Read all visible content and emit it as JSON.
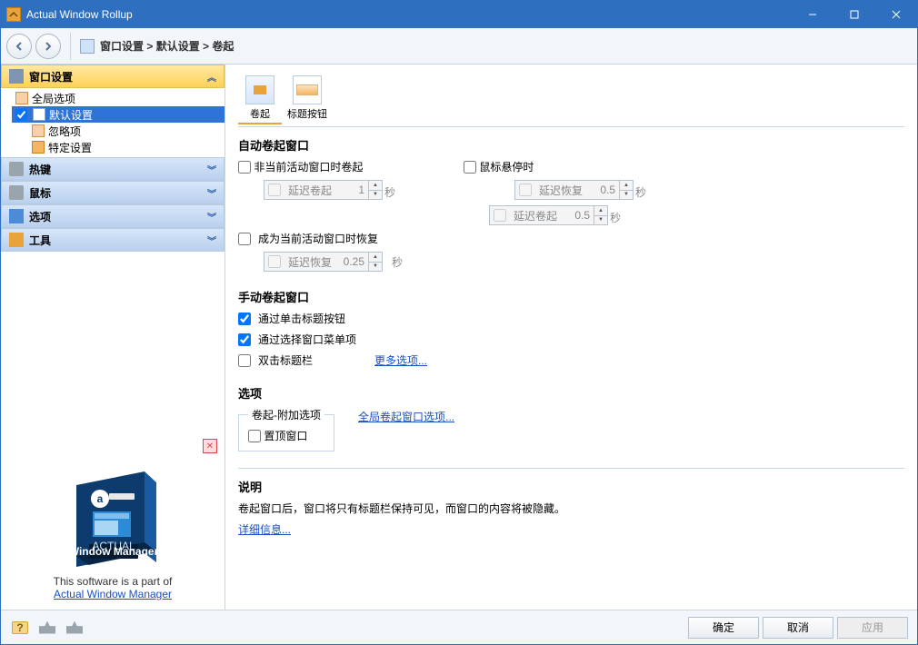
{
  "titlebar": {
    "title": "Actual Window Rollup"
  },
  "breadcrumb": {
    "a": "窗口设置",
    "b": "默认设置",
    "c": "卷起"
  },
  "sidebar": {
    "headers": {
      "window": "窗口设置",
      "hotkey": "热键",
      "mouse": "鼠标",
      "options": "选项",
      "tools": "工具"
    },
    "tree": {
      "global": "全局选项",
      "default": "默认设置",
      "ignore": "忽略项",
      "specific": "特定设置"
    },
    "promo_text": "This software is a part of",
    "promo_link": "Actual Window Manager"
  },
  "tabs": {
    "rollup": "卷起",
    "titlebtn": "标题按钮"
  },
  "auto": {
    "title": "自动卷起窗口",
    "inactive": "非当前活动窗口时卷起",
    "delay_rollup": "延迟卷起",
    "delay_rollup_val": "1",
    "restore_active": "成为当前活动窗口时恢复",
    "delay_restore": "延迟恢复",
    "delay_restore_val": "0.25",
    "hover": "鼠标悬停时",
    "hover_restore": "延迟恢复",
    "hover_restore_val": "0.5",
    "hover_rollup": "延迟卷起",
    "hover_rollup_val": "0.5",
    "sec": "秒"
  },
  "manual": {
    "title": "手动卷起窗口",
    "click_btn": "通过单击标题按钮",
    "menu": "通过选择窗口菜单项",
    "dbl": "双击标题栏",
    "more": "更多选项..."
  },
  "options": {
    "title": "选项",
    "legend": "卷起-附加选项",
    "topmost": "置顶窗口",
    "global_link": "全局卷起窗口选项..."
  },
  "desc": {
    "title": "说明",
    "text": "卷起窗口后，窗口将只有标题栏保持可见，而窗口的内容将被隐藏。",
    "more": "详细信息..."
  },
  "footer": {
    "ok": "确定",
    "cancel": "取消",
    "apply": "应用"
  }
}
